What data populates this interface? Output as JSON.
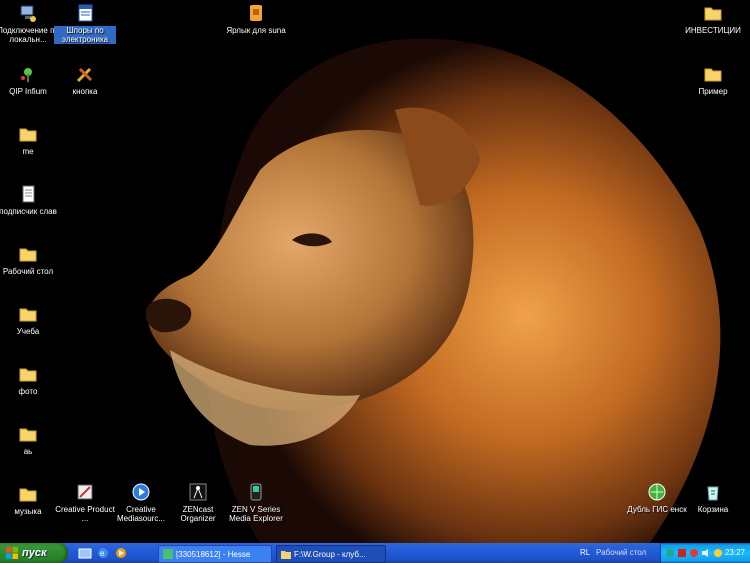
{
  "desktop": {
    "icons": [
      {
        "id": "net",
        "label": "Подключение по локальн..."
      },
      {
        "id": "doc",
        "label": "Шпоры по электроника"
      },
      {
        "id": "label",
        "label": "Ярлык для suna"
      },
      {
        "id": "folder-inv",
        "label": "ИНВЕСТИЦИИ"
      },
      {
        "id": "qip",
        "label": "QIP Infium"
      },
      {
        "id": "knopka",
        "label": "кнопка"
      },
      {
        "id": "folder-primer",
        "label": "Пример"
      },
      {
        "id": "folder-me",
        "label": "me"
      },
      {
        "id": "txt",
        "label": "подписчик слав"
      },
      {
        "id": "folder-desk",
        "label": "Рабочий стол"
      },
      {
        "id": "folder-ucheba",
        "label": "Учеба"
      },
      {
        "id": "folder-photo",
        "label": "фото"
      },
      {
        "id": "folder-ab",
        "label": "аь"
      },
      {
        "id": "folder-music",
        "label": "музыка"
      },
      {
        "id": "creative1",
        "label": "Creative Product ..."
      },
      {
        "id": "creative2",
        "label": "Creative Mediasourc..."
      },
      {
        "id": "zen1",
        "label": "ZENcast Organizer"
      },
      {
        "id": "zen2",
        "label": "ZEN V Series Media Explorer"
      },
      {
        "id": "dubl",
        "label": "Дубль ГИС енск"
      },
      {
        "id": "recycle",
        "label": "Корзина"
      }
    ]
  },
  "taskbar": {
    "start_label": "пуск",
    "tasks": [
      {
        "label": "[330518612] - Hesse"
      },
      {
        "label": "F:\\W.Group - клуб..."
      }
    ],
    "lang": "RL",
    "desk_label": "Рабочий стол",
    "clock": "23:27"
  },
  "colors": {
    "taskbar": "#245edb",
    "start": "#2f8f2f",
    "tray": "#18b9ff",
    "selection": "#316ac5"
  }
}
